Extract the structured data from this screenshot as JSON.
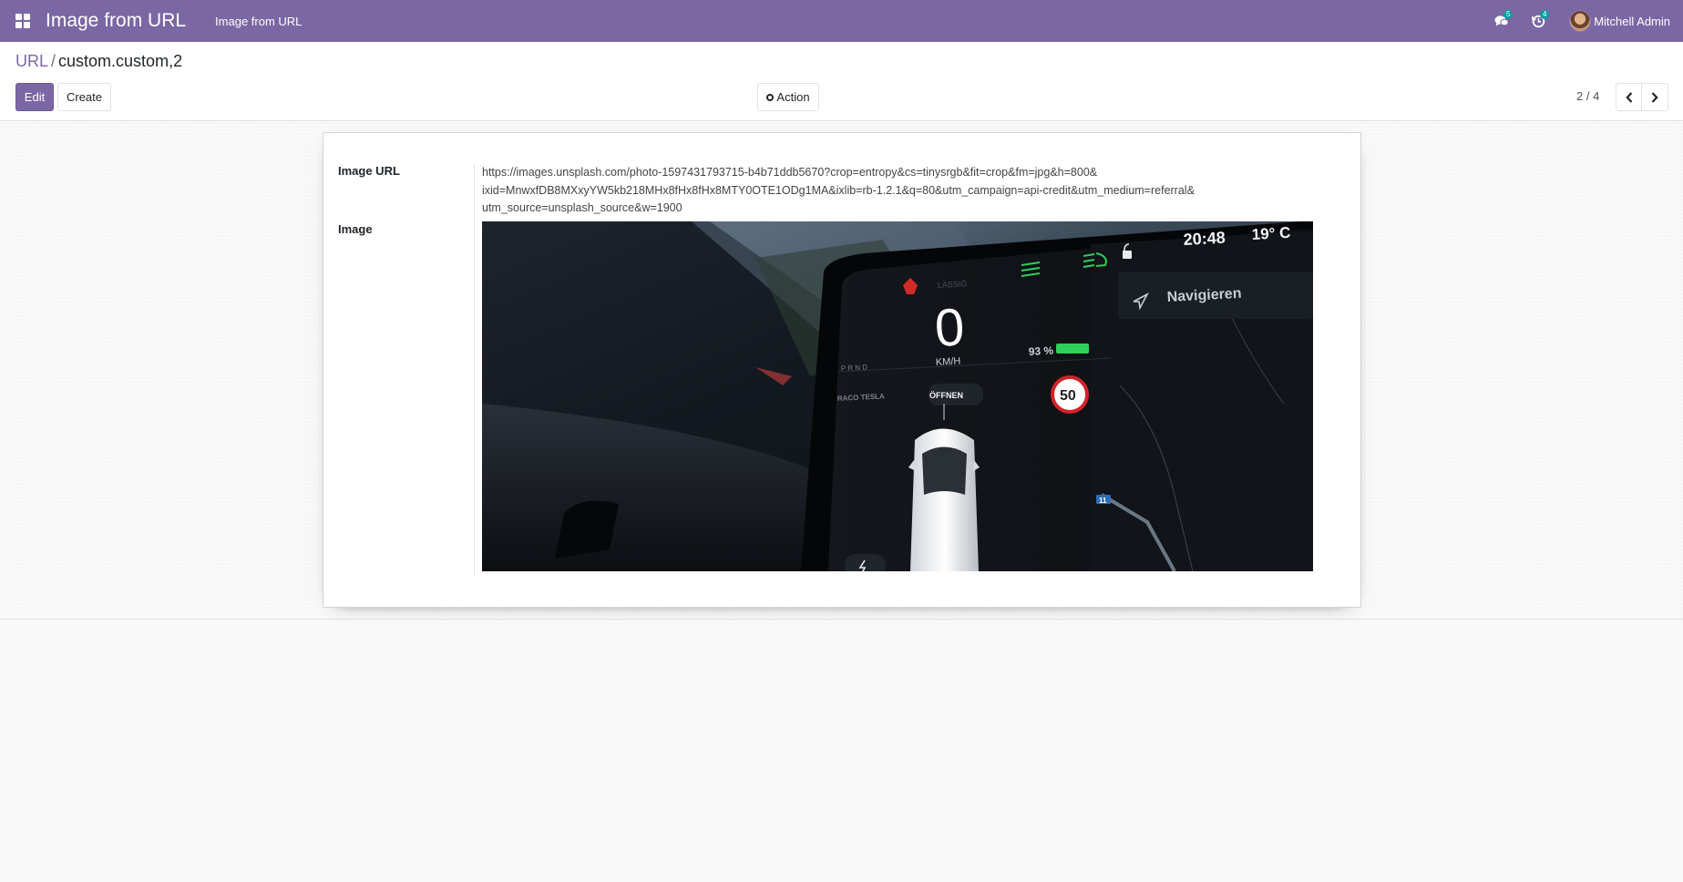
{
  "navbar": {
    "app_title": "Image from URL",
    "menu_item": "Image from URL",
    "messages_badge": "5",
    "activities_badge": "4",
    "user_name": "Mitchell Admin"
  },
  "breadcrumb": {
    "parent": "URL",
    "current": "custom.custom,2"
  },
  "buttons": {
    "edit": "Edit",
    "create": "Create",
    "action": "Action"
  },
  "pager": {
    "value": "2 / 4"
  },
  "form": {
    "image_url_label": "Image URL",
    "image_url_lines": [
      "https://images.unsplash.com/photo-1597431793715-b4b71ddb5670?crop=entropy&cs=tinysrgb&fit=crop&fm=jpg&h=800&",
      "ixid=MnwxfDB8MXxyYW5kb218MHx8fHx8fHx8MTY0OTE1ODg1MA&ixlib=rb-1.2.1&q=80&utm_campaign=api-credit&utm_medium=referral&",
      "utm_source=unsplash_source&w=1900"
    ],
    "image_label": "Image"
  },
  "photo_text": {
    "clock": "20:48",
    "temperature": "19° C",
    "navigate": "Navigieren",
    "speed": "0",
    "speed_unit": "KM/H",
    "battery": "93 %",
    "lassig": "LÄSSIG",
    "prnd": "P R N D",
    "raco": "RACO TESLA",
    "open": "ÖFFNEN",
    "speed_limit": "50",
    "route_marker": "11"
  },
  "colors": {
    "brand": "#7a67a4",
    "badge": "#00a09d",
    "tesla_green": "#2fd05a"
  }
}
